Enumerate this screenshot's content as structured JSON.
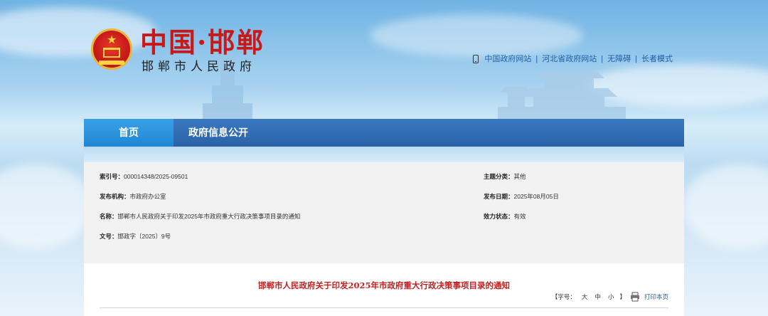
{
  "header": {
    "title": "中国·邯郸",
    "subtitle": "邯郸市人民政府",
    "links": [
      "中国政府网站",
      "河北省政府网站",
      "无障碍",
      "长者模式"
    ],
    "separator": "|"
  },
  "nav": {
    "tabs": [
      {
        "label": "首页"
      },
      {
        "label": "政府信息公开"
      }
    ]
  },
  "meta": {
    "index_no": {
      "label": "索引号：",
      "value": "000014348/2025-09501"
    },
    "category": {
      "label": "主题分类：",
      "value": "其他"
    },
    "publisher": {
      "label": "发布机构：",
      "value": "市政府办公室"
    },
    "publish_date": {
      "label": "发布日期：",
      "value": "2025年08月05日"
    },
    "name": {
      "label": "名称：",
      "value": "邯郸市人民政府关于印发2025年市政府重大行政决策事项目录的通知"
    },
    "validity": {
      "label": "效力状态：",
      "value": "有效"
    },
    "doc_no": {
      "label": "文号：",
      "value": "邯政字〔2025〕9号"
    }
  },
  "article": {
    "title": "邯郸市人民政府关于印发2025年市政府重大行政决策事项目录的通知",
    "font_size_label": "【字号：",
    "sizes": [
      "大",
      "中",
      "小"
    ],
    "font_size_close": "】",
    "print_label": "打印本页"
  },
  "colors": {
    "brand_red": "#c81919",
    "nav_blue": "#2a62a8",
    "nav_active": "#1f86d4",
    "link_blue": "#1f5fa8"
  },
  "icons": {
    "phone": "phone-icon",
    "print": "printer-icon",
    "emblem": "national-emblem"
  }
}
